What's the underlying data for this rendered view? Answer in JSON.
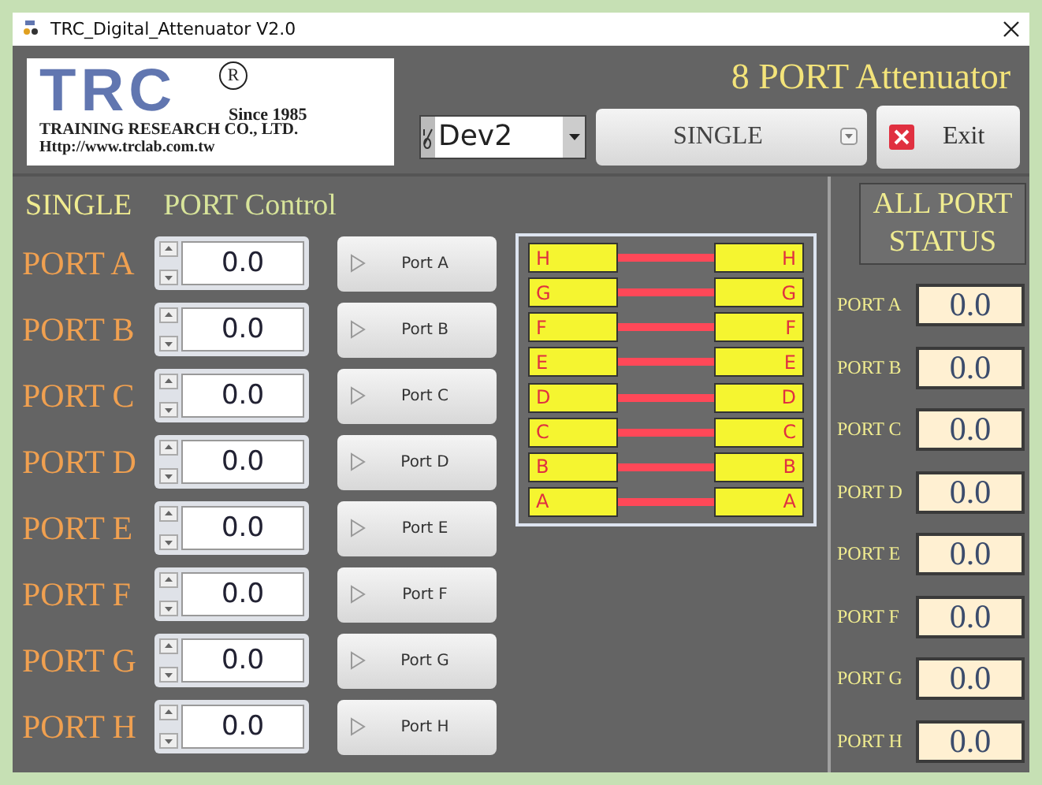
{
  "window": {
    "title": "TRC_Digital_Attenuator V2.0"
  },
  "logo": {
    "mark": "TRC",
    "registered": "R",
    "since": "Since 1985",
    "company": "TRAINING RESEARCH CO., LTD.",
    "url": "Http://www.trclab.com.tw"
  },
  "heading": "8 PORT Attenuator",
  "device": {
    "value": "Dev2"
  },
  "mode": {
    "value": "SINGLE"
  },
  "exit_button": "Exit",
  "control_title": {
    "mode": "SINGLE",
    "label": "PORT Control"
  },
  "ports": [
    {
      "label": "PORT A",
      "value": "0.0",
      "button": "Port A"
    },
    {
      "label": "PORT B",
      "value": "0.0",
      "button": "Port B"
    },
    {
      "label": "PORT C",
      "value": "0.0",
      "button": "Port C"
    },
    {
      "label": "PORT D",
      "value": "0.0",
      "button": "Port D"
    },
    {
      "label": "PORT E",
      "value": "0.0",
      "button": "Port E"
    },
    {
      "label": "PORT F",
      "value": "0.0",
      "button": "Port F"
    },
    {
      "label": "PORT G",
      "value": "0.0",
      "button": "Port G"
    },
    {
      "label": "PORT H",
      "value": "0.0",
      "button": "Port H"
    }
  ],
  "diagram": {
    "channels": [
      {
        "left": "H",
        "right": "H"
      },
      {
        "left": "G",
        "right": "G"
      },
      {
        "left": "F",
        "right": "F"
      },
      {
        "left": "E",
        "right": "E"
      },
      {
        "left": "D",
        "right": "D"
      },
      {
        "left": "C",
        "right": "C"
      },
      {
        "left": "B",
        "right": "B"
      },
      {
        "left": "A",
        "right": "A"
      }
    ]
  },
  "status": {
    "title": "ALL PORT STATUS",
    "rows": [
      {
        "label": "PORT A",
        "value": "0.0"
      },
      {
        "label": "PORT B",
        "value": "0.0"
      },
      {
        "label": "PORT C",
        "value": "0.0"
      },
      {
        "label": "PORT D",
        "value": "0.0"
      },
      {
        "label": "PORT E",
        "value": "0.0"
      },
      {
        "label": "PORT F",
        "value": "0.0"
      },
      {
        "label": "PORT G",
        "value": "0.0"
      },
      {
        "label": "PORT H",
        "value": "0.0"
      }
    ]
  }
}
